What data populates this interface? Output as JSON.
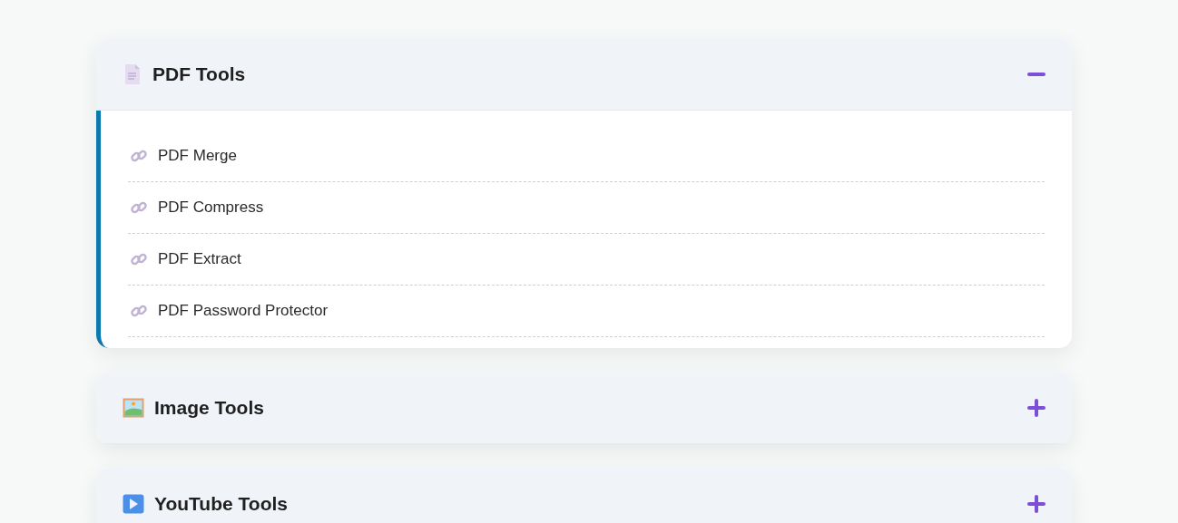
{
  "sections": [
    {
      "title": "PDF Tools",
      "kind": "document",
      "expanded": true,
      "items": [
        "PDF Merge",
        "PDF Compress",
        "PDF Extract",
        "PDF Password Protector"
      ]
    },
    {
      "title": "Image Tools",
      "kind": "image",
      "expanded": false
    },
    {
      "title": "YouTube Tools",
      "kind": "video",
      "expanded": false
    }
  ]
}
